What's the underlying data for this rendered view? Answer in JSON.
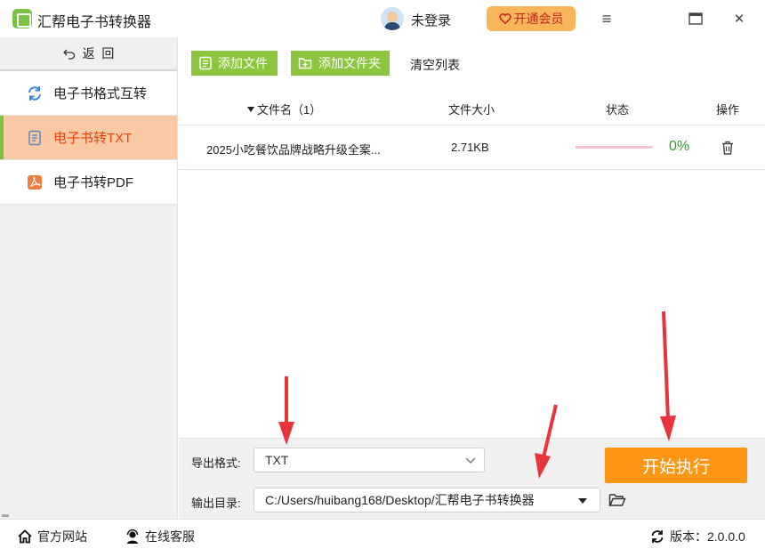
{
  "app": {
    "title": "汇帮电子书转换器"
  },
  "user": {
    "login_label": "未登录",
    "vip_label": "开通会员"
  },
  "window_controls": {
    "menu": "≡",
    "maximize": "▭",
    "close": "✕"
  },
  "sidebar": {
    "back_label": "返  回",
    "items": [
      {
        "label": "电子书格式互转",
        "icon": "refresh-icon",
        "active": false
      },
      {
        "label": "电子书转TXT",
        "icon": "document-icon",
        "active": true
      },
      {
        "label": "电子书转PDF",
        "icon": "pdf-icon",
        "active": false
      }
    ]
  },
  "toolbar": {
    "add_file": "添加文件",
    "add_folder": "添加文件夹",
    "clear_list": "清空列表"
  },
  "table": {
    "headers": {
      "name": "文件名（1）",
      "size": "文件大小",
      "status": "状态",
      "action": "操作"
    },
    "rows": [
      {
        "name": "2025小吃餐饮品牌战略升级全案...",
        "size": "2.71KB",
        "progress": 0,
        "progress_text": "0%"
      }
    ]
  },
  "settings": {
    "format_label": "导出格式:",
    "format_value": "TXT",
    "output_label": "输出目录:",
    "output_value": "C:/Users/huibang168/Desktop/汇帮电子书转换器",
    "start_label": "开始执行"
  },
  "statusbar": {
    "website": "官方网站",
    "support": "在线客服",
    "version": "版本：2.0.0.0"
  },
  "colors": {
    "accent_green": "#8cc63f",
    "accent_orange": "#ff9613",
    "active_nav_bg": "#f9c9a6",
    "active_nav_text": "#e8430a",
    "annotation_red": "#e8343a"
  }
}
